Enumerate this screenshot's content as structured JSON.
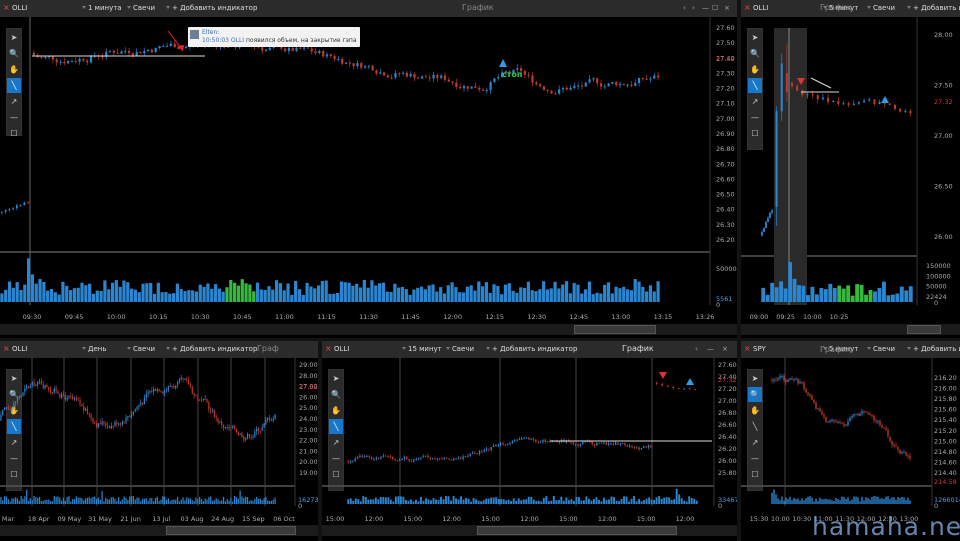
{
  "windows": {
    "main": {
      "symbol": "OLLI",
      "timeframe": "1 минута",
      "chart_type": "Свечи",
      "add_indicator": "+ Добавить индикатор",
      "title": "График",
      "controls": [
        "‹",
        "›",
        "—",
        "☐",
        "×"
      ],
      "price_labels": [
        "27.60",
        "27.50",
        "27.40",
        "27.30",
        "27.20",
        "27.10",
        "27.00",
        "26.90",
        "26.80",
        "26.70",
        "26.60",
        "26.50",
        "26.40",
        "26.30",
        "26.20"
      ],
      "current_price": "27.32",
      "vol_labels": [
        "50000",
        "5561",
        "0"
      ],
      "time_labels": [
        "09:30",
        "09:45",
        "10:00",
        "10:15",
        "10:30",
        "10:45",
        "11:00",
        "11:15",
        "11:30",
        "11:45",
        "12:00",
        "12:15",
        "12:30",
        "12:45",
        "13:00",
        "13:15",
        "13:26"
      ],
      "note": {
        "author": "Elten:",
        "time": "10:50:03",
        "symbol": "OLLI",
        "text": "появился объем, на закрытие гэпа"
      },
      "stop_label": "стоп"
    },
    "topright": {
      "symbol": "OLLI",
      "timeframe": "5 минут",
      "chart_type": "Свечи",
      "add_indicator": "+ Добавить индикатор",
      "title": "График",
      "price_labels": [
        "28.00",
        "27.50",
        "27.00",
        "26.50",
        "26.00"
      ],
      "current_price": "27.32",
      "vol_labels": [
        "150000",
        "100000",
        "50000",
        "22424",
        "0"
      ],
      "time_labels": [
        "09:00",
        "09:25",
        "10:00",
        "10:25"
      ]
    },
    "bottomleft": {
      "symbol": "OLLI",
      "timeframe": "День",
      "chart_type": "Свечи",
      "add_indicator": "+ Добавить индикатор",
      "title": "Граф",
      "price_labels": [
        "29.00",
        "28.00",
        "27.00",
        "26.00",
        "25.00",
        "24.00",
        "23.00",
        "22.00",
        "21.00",
        "20.00",
        "19.00"
      ],
      "current_price": "27.32",
      "vol_labels": [
        "1627343",
        "0"
      ],
      "time_labels": [
        "Mar",
        "18 Apr",
        "09 May",
        "31 May",
        "21 Jun",
        "13 Jul",
        "03 Aug",
        "24 Aug",
        "15 Sep",
        "06 Oct"
      ]
    },
    "bottommid": {
      "symbol": "OLLI",
      "timeframe": "15 минут",
      "chart_type": "Свечи",
      "add_indicator": "+ Добавить индикатор",
      "title": "График",
      "price_labels": [
        "27.60",
        "27.40",
        "27.20",
        "27.00",
        "26.80",
        "26.60",
        "26.40",
        "26.20",
        "26.00",
        "25.80"
      ],
      "current_price": "27.32",
      "vol_labels": [
        "33467",
        "0"
      ],
      "time_labels": [
        "15:00",
        "12:00",
        "15:00",
        "12:00",
        "15:00",
        "12:00",
        "15:00",
        "12:00",
        "15:00",
        "12:00"
      ]
    },
    "bottomright": {
      "symbol": "SPY",
      "timeframe": "5 минут",
      "chart_type": "Свечи",
      "add_indicator": "+ Добавить индикатор",
      "title": "График",
      "price_labels": [
        "216.20",
        "216.00",
        "215.80",
        "215.60",
        "215.40",
        "215.20",
        "215.00",
        "214.80",
        "214.60",
        "214.40"
      ],
      "current_price": "214.58",
      "vol_labels": [
        "1266014",
        "0"
      ],
      "time_labels": [
        "15:30",
        "10:00",
        "10:30",
        "11:00",
        "11:30",
        "12:00",
        "12:30",
        "13:00"
      ]
    }
  },
  "watermark": "hamaha.net",
  "tools": [
    "cursor-icon",
    "zoom-icon",
    "hand-icon",
    "line-icon",
    "arrow-icon",
    "hline-icon",
    "rect-icon"
  ],
  "colors": {
    "bull": "#2a86d1",
    "bear": "#c0392b",
    "volume": "#2a86d1",
    "volume_hl": "#36b93c",
    "bg": "#000000",
    "toolbar": "#2b2b2b",
    "accent": "#1877c9"
  }
}
